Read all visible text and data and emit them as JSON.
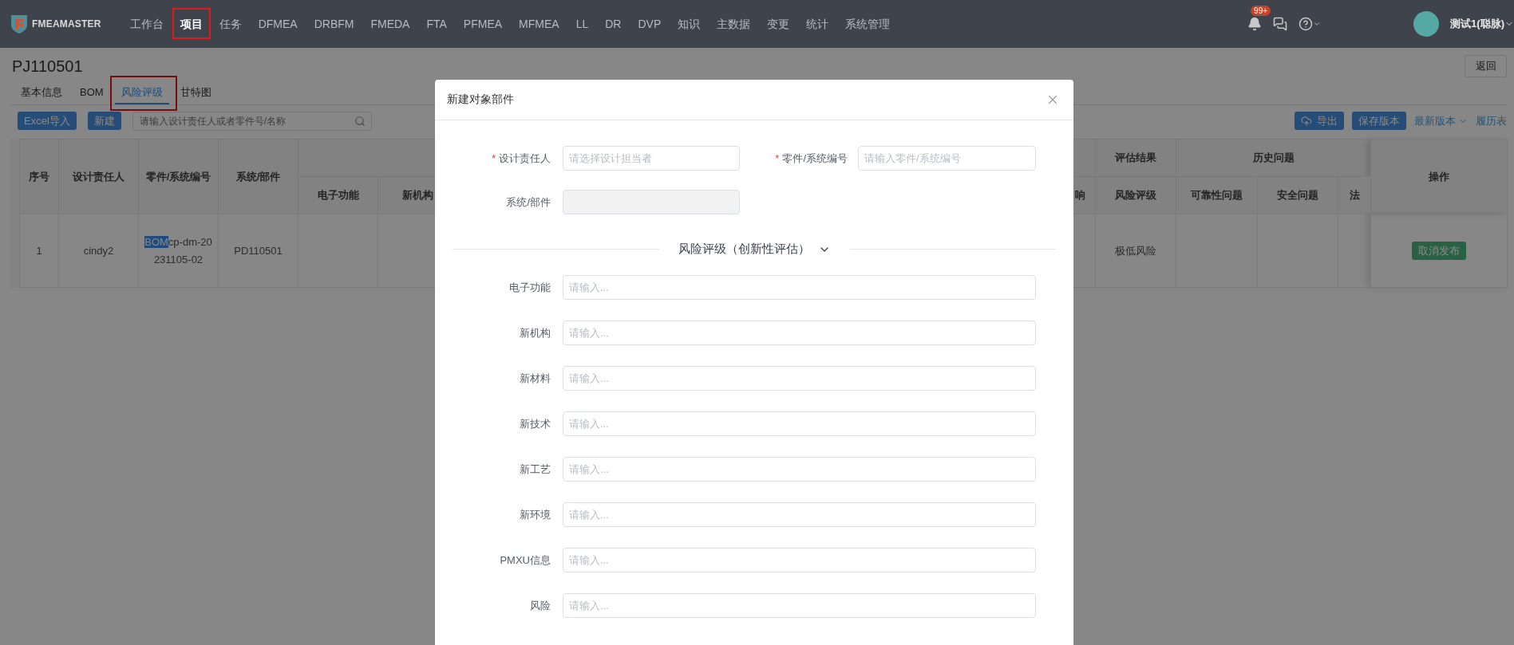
{
  "header": {
    "logo": "FMEAMASTER",
    "nav": [
      {
        "label": "工作台",
        "selected": false,
        "highlighted": false
      },
      {
        "label": "项目",
        "selected": true,
        "highlighted": true
      },
      {
        "label": "任务",
        "selected": false,
        "highlighted": false
      },
      {
        "label": "DFMEA",
        "selected": false,
        "highlighted": false
      },
      {
        "label": "DRBFM",
        "selected": false,
        "highlighted": false
      },
      {
        "label": "FMEDA",
        "selected": false,
        "highlighted": false
      },
      {
        "label": "FTA",
        "selected": false,
        "highlighted": false
      },
      {
        "label": "PFMEA",
        "selected": false,
        "highlighted": false
      },
      {
        "label": "MFMEA",
        "selected": false,
        "highlighted": false
      },
      {
        "label": "LL",
        "selected": false,
        "highlighted": false
      },
      {
        "label": "DR",
        "selected": false,
        "highlighted": false
      },
      {
        "label": "DVP",
        "selected": false,
        "highlighted": false
      },
      {
        "label": "知识",
        "selected": false,
        "highlighted": false
      },
      {
        "label": "主数据",
        "selected": false,
        "highlighted": false
      },
      {
        "label": "变更",
        "selected": false,
        "highlighted": false
      },
      {
        "label": "统计",
        "selected": false,
        "highlighted": false
      },
      {
        "label": "系统管理",
        "selected": false,
        "highlighted": false
      }
    ],
    "notification_badge": "99+",
    "user_name": "测试1(聪脉)"
  },
  "page": {
    "title": "PJ110501",
    "back_button": "返回",
    "tabs": [
      {
        "label": "基本信息",
        "selected": false,
        "highlighted": false
      },
      {
        "label": "BOM",
        "selected": false,
        "highlighted": false
      },
      {
        "label": "风险评级",
        "selected": true,
        "highlighted": true
      },
      {
        "label": "甘特图",
        "selected": false,
        "highlighted": false
      }
    ]
  },
  "toolbar": {
    "buttons": [
      "Excel导入",
      "新建"
    ],
    "search": {
      "placeholder": "请输入设计责任人或者零件号/名称"
    },
    "export_button": "导出",
    "save_version_button": "保存版本",
    "version_dropdown": "最新版本",
    "history_link": "履历表"
  },
  "table": {
    "columns": [
      {
        "kind": "single",
        "label": "序号"
      },
      {
        "kind": "single",
        "label": "设计责任人"
      },
      {
        "kind": "single",
        "label": "零件/系统编号"
      },
      {
        "kind": "single",
        "label": "系统/部件"
      },
      {
        "kind": "group_start",
        "label": "电子功能"
      },
      {
        "kind": "group_member",
        "label": "新机构"
      },
      {
        "kind": "group_member",
        "label": "响"
      },
      {
        "kind": "group_start",
        "group": "评估结果",
        "label": "风险评级"
      },
      {
        "kind": "group_start",
        "group": "历史问题",
        "label": "可靠性问题"
      },
      {
        "kind": "group_member",
        "label": "安全问题"
      },
      {
        "kind": "group_member",
        "label": "法"
      },
      {
        "kind": "single",
        "label": "操作"
      }
    ],
    "rows": [
      {
        "cells": [
          {
            "kind": "text",
            "text": "1"
          },
          {
            "kind": "text",
            "text": "cindy2"
          },
          {
            "kind": "text",
            "selected_part": "BOM",
            "text": "cp-dm-20231105-02"
          },
          {
            "kind": "text",
            "text": "PD110501"
          },
          null,
          null,
          null,
          {
            "kind": "text",
            "text": "极低风险"
          },
          null,
          null,
          null,
          {
            "kind": "button",
            "text": "取消发布"
          }
        ]
      }
    ]
  },
  "modal": {
    "title": "新建对象部件",
    "required_mark": "*",
    "top_fields": [
      {
        "label": "设计责任人",
        "required": true,
        "placeholder": "请选择设计担当者",
        "disabled": false
      },
      {
        "label": "零件/系统编号",
        "required": true,
        "placeholder": "请输入零件/系统编号",
        "disabled": false
      },
      {
        "label": "系统/部件",
        "required": false,
        "disabled": true
      }
    ],
    "section": {
      "title": "风险评级（创新性评估）",
      "expanded": true
    },
    "fields": [
      {
        "label": "电子功能",
        "placeholder": "请输入..."
      },
      {
        "label": "新机构",
        "placeholder": "请输入..."
      },
      {
        "label": "新材料",
        "placeholder": "请输入..."
      },
      {
        "label": "新技术",
        "placeholder": "请输入..."
      },
      {
        "label": "新工艺",
        "placeholder": "请输入..."
      },
      {
        "label": "新环境",
        "placeholder": "请输入..."
      },
      {
        "label": "PMXU信息",
        "placeholder": "请输入..."
      },
      {
        "label": "风险",
        "placeholder": "请输入..."
      }
    ]
  }
}
